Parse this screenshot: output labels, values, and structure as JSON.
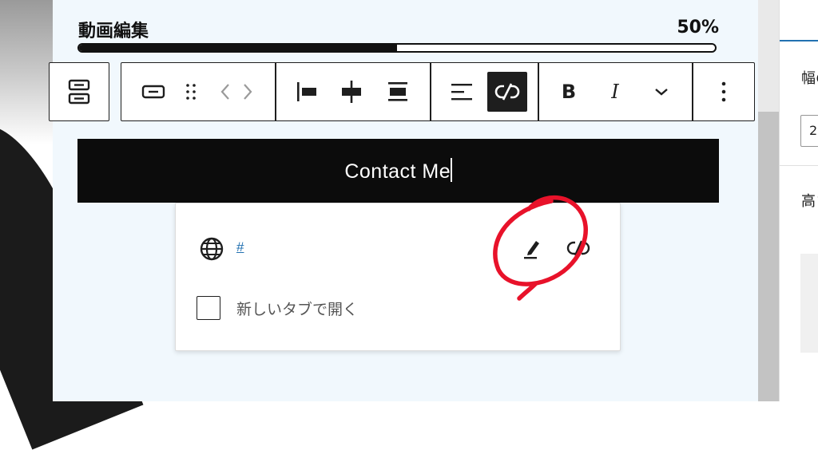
{
  "progress": {
    "label": "動画編集",
    "value_text": "50%",
    "value": 0.5
  },
  "toolbar": {
    "parent_selector_icon": "buttons-block-icon",
    "button_block_icon": "button-block-icon",
    "drag_icon": "drag-handle-icon",
    "move_icon": "move-arrows-icon",
    "justify_items": [
      "justify-left-icon",
      "justify-center-icon",
      "justify-space-between-icon"
    ],
    "align_icon": "align-left-icon",
    "unlink_icon": "unlink-icon",
    "bold_label": "B",
    "italic_label": "I",
    "more_rich_text_icon": "chevron-down-icon",
    "options_icon": "more-vertical-icon"
  },
  "button_block": {
    "text": "Contact Me"
  },
  "link_popover": {
    "url": "#",
    "open_new_tab_label": "新しいタブで開く",
    "open_new_tab_checked": false,
    "edit_icon": "pencil-icon",
    "unlink_icon": "unlink-icon",
    "globe_icon": "globe-icon"
  },
  "sidebar": {
    "width_label": "幅の",
    "width_value": "2",
    "height_label": "高さ"
  },
  "colors": {
    "canvas_bg": "#f1f8fd",
    "toolbar_border": "#1e1e1e",
    "button_bg": "#0c0c0c",
    "link_color": "#2271b1",
    "annotation_red": "#e8122a"
  }
}
